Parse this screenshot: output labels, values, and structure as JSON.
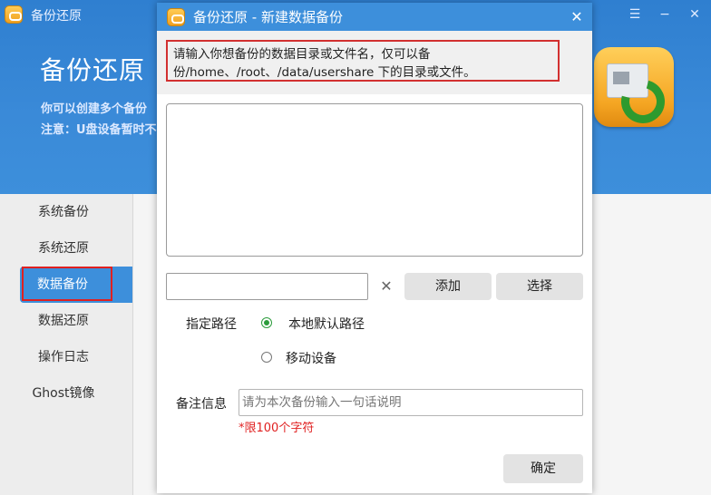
{
  "app": {
    "title": "备份还原",
    "window_controls": {
      "menu": "☰",
      "minimize": "−",
      "close": "✕"
    },
    "hero": {
      "title": "备份还原",
      "desc": "你可以创建多个备份",
      "note": "注意：U盘设备暂时不"
    },
    "sidebar": {
      "items": [
        {
          "label": "系统备份"
        },
        {
          "label": "系统还原"
        },
        {
          "label": "数据备份"
        },
        {
          "label": "数据还原"
        },
        {
          "label": "操作日志"
        },
        {
          "label": "Ghost镜像"
        }
      ],
      "active_index": 2
    }
  },
  "dialog": {
    "title": "备份还原 - 新建数据备份",
    "close_icon": "✕",
    "info": "请输入你想备份的数据目录或文件名，仅可以备份/home、/root、/data/usershare 下的目录或文件。",
    "path_input_value": "",
    "clear_icon": "✕",
    "add_label": "添加",
    "select_label": "选择",
    "path_label": "指定路径",
    "radio_options": [
      {
        "label": "本地默认路径",
        "checked": true
      },
      {
        "label": "移动设备",
        "checked": false
      }
    ],
    "note_label": "备注信息",
    "note_placeholder": "请为本次备份输入一句话说明",
    "limit_text": "*限100个字符",
    "ok_label": "确定"
  },
  "colors": {
    "accent": "#3d8fdb",
    "highlight_border": "#d23030",
    "radio_checked": "#2c9c3c",
    "warning_text": "#e02020"
  }
}
